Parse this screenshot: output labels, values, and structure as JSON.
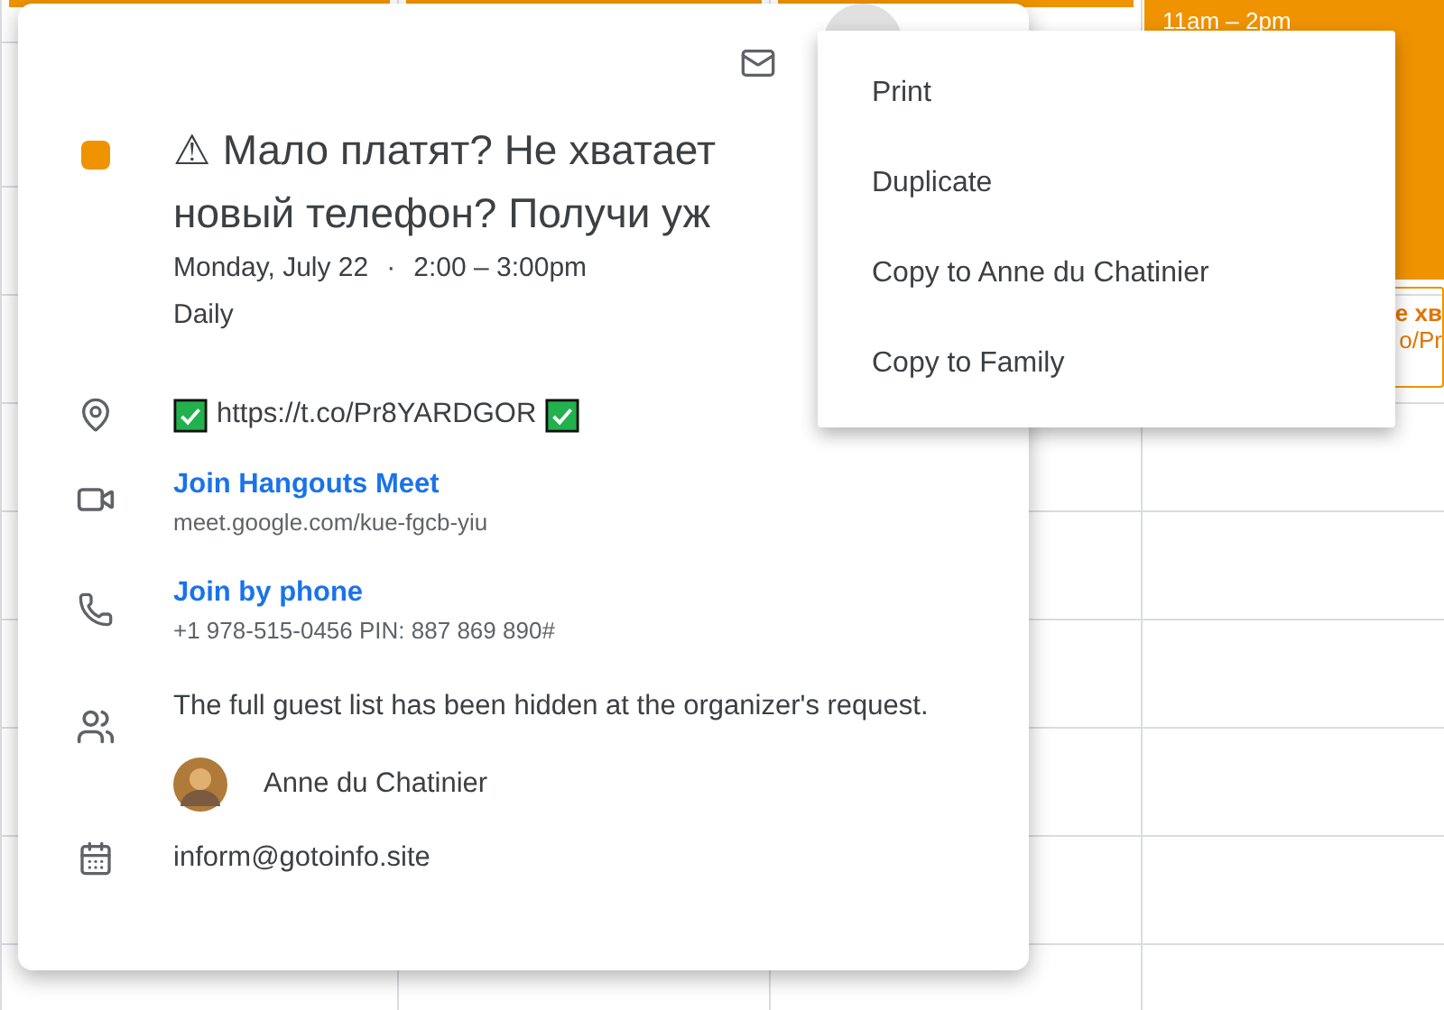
{
  "calendar": {
    "events": [
      {
        "time": "11am – 2pm"
      },
      {
        "title": "е хв",
        "detail": "o/Pr"
      }
    ]
  },
  "event_card": {
    "color": "#f09300",
    "title_lines": [
      "⚠ Мало платят? Не хватает",
      "новый телефон? Получи уж"
    ],
    "date": "Monday, July 22",
    "separator": "·",
    "time": "2:00 – 3:00pm",
    "recurrence": "Daily",
    "location": "https://t.co/Pr8YARDGOR",
    "conference": {
      "link": "Join Hangouts Meet",
      "url": "meet.google.com/kue-fgcb-yiu"
    },
    "phone": {
      "link": "Join by phone",
      "details": "+1 978-515-0456 PIN: 887 869 890#"
    },
    "guests": {
      "note": "The full guest list has been hidden at the organizer's request.",
      "people": [
        {
          "name": "Anne du Chatinier"
        }
      ]
    },
    "calendar_name": "inform@gotoinfo.site"
  },
  "menu": {
    "items": [
      {
        "label": "Print"
      },
      {
        "label": "Duplicate"
      },
      {
        "label": "Copy to Anne du Chatinier"
      },
      {
        "label": "Copy to Family"
      }
    ]
  }
}
